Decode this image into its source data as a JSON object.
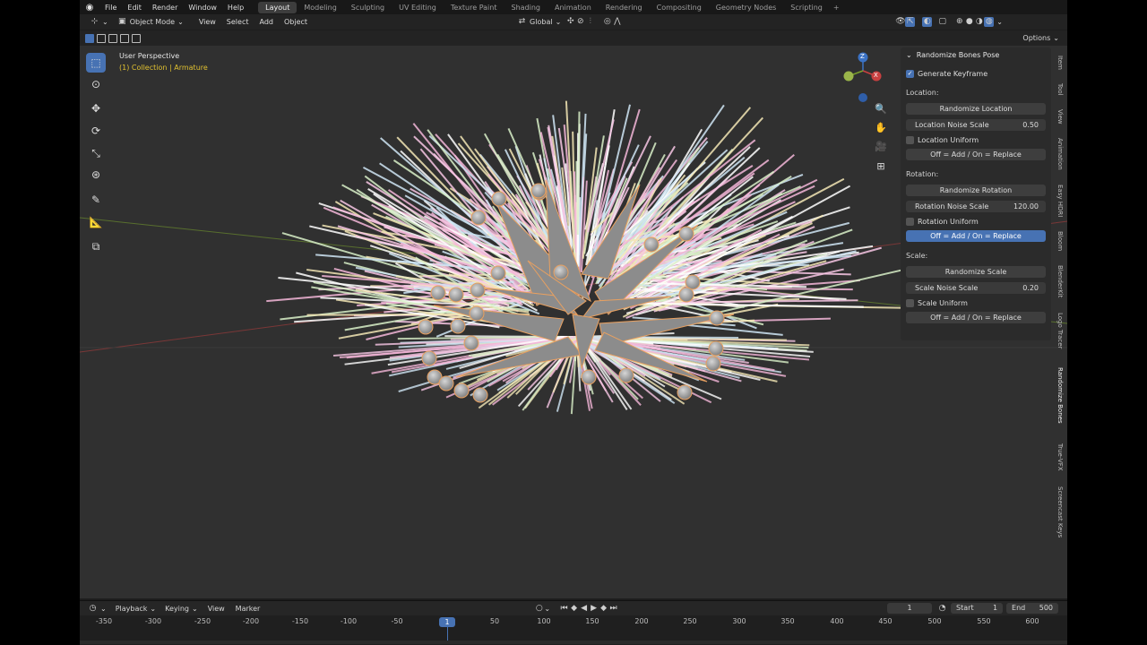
{
  "topbar": {
    "menus": [
      "File",
      "Edit",
      "Render",
      "Window",
      "Help"
    ],
    "workspaces": [
      "Layout",
      "Modeling",
      "Sculpting",
      "UV Editing",
      "Texture Paint",
      "Shading",
      "Animation",
      "Rendering",
      "Compositing",
      "Geometry Nodes",
      "Scripting"
    ],
    "active_workspace": "Layout"
  },
  "header": {
    "mode": "Object Mode",
    "menus": [
      "View",
      "Select",
      "Add",
      "Object"
    ],
    "transform_orientation": "Global",
    "options_label": "Options"
  },
  "viewport": {
    "title": "User Perspective",
    "collection": "(1) Collection",
    "object": "Armature",
    "gizmo_z": "Z",
    "gizmo_x": "X"
  },
  "panel": {
    "title": "Randomize Bones Pose",
    "generate_keyframe": {
      "label": "Generate Keyframe",
      "checked": true
    },
    "location": {
      "section": "Location:",
      "button": "Randomize Location",
      "noise_label": "Location Noise Scale",
      "noise_value": "0.50",
      "uniform": "Location Uniform",
      "mode": "Off = Add / On = Replace"
    },
    "rotation": {
      "section": "Rotation:",
      "button": "Randomize Rotation",
      "noise_label": "Rotation Noise Scale",
      "noise_value": "120.00",
      "uniform": "Rotation Uniform",
      "mode": "Off = Add / On = Replace"
    },
    "scale": {
      "section": "Scale:",
      "button": "Randomize Scale",
      "noise_label": "Scale Noise Scale",
      "noise_value": "0.20",
      "uniform": "Scale Uniform",
      "mode": "Off = Add / On = Replace"
    }
  },
  "sidebar_tabs": [
    "Item",
    "Tool",
    "View",
    "Animation",
    "Easy HDRI",
    "Bloom",
    "BlenderKit",
    "Logo Tracer",
    "Randomize Bones",
    "True-VFX",
    "Screencast Keys"
  ],
  "timeline": {
    "menus": [
      "Playback",
      "Keying",
      "View",
      "Marker"
    ],
    "current_frame": "1",
    "start_label": "Start",
    "start_value": "1",
    "end_label": "End",
    "end_value": "500",
    "ruler": [
      "-350",
      "-300",
      "-250",
      "-200",
      "-150",
      "-100",
      "-50",
      "50",
      "100",
      "150",
      "200",
      "250",
      "300",
      "350",
      "400",
      "450",
      "500",
      "550",
      "600"
    ],
    "ruler_current": "1"
  },
  "colors": {
    "accent": "#4772b3",
    "selection": "#e8a060",
    "axis_x": "#d14a4a",
    "axis_y": "#7ea33a"
  }
}
